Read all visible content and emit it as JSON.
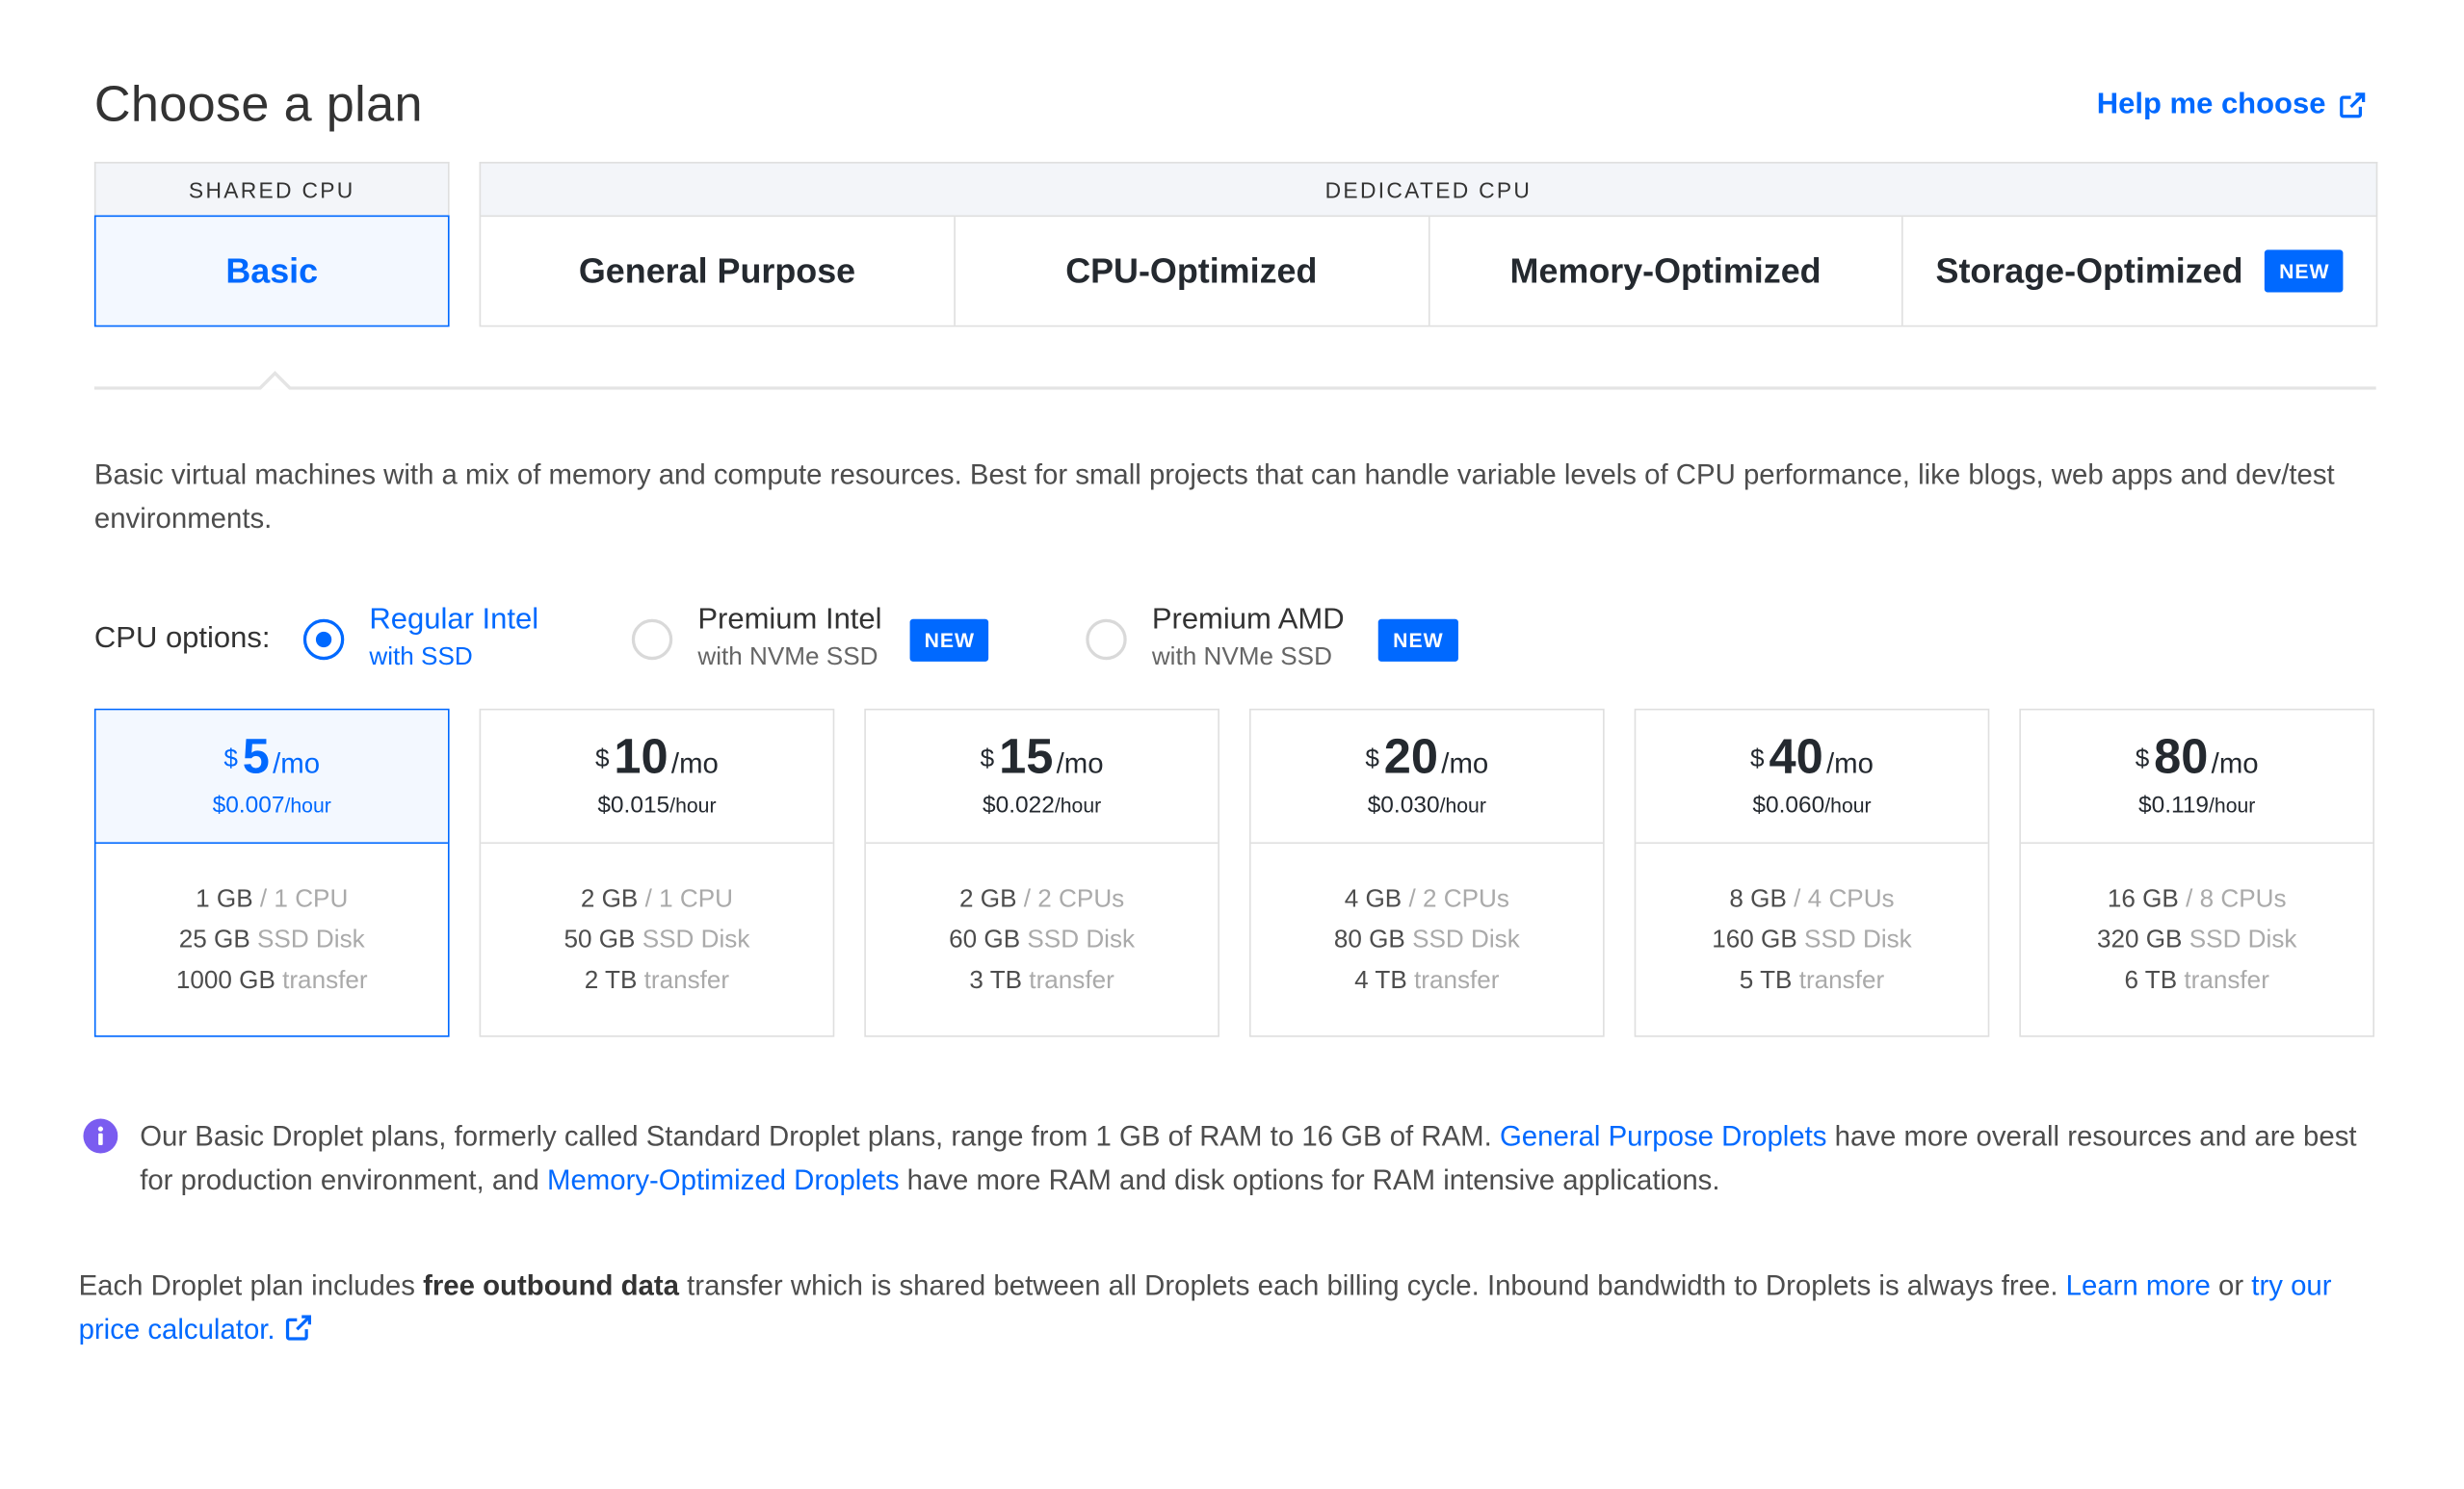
{
  "header": {
    "title": "Choose a plan",
    "help_label": "Help me choose"
  },
  "tab_groups": {
    "shared_label": "SHARED CPU",
    "dedicated_label": "DEDICATED CPU"
  },
  "tabs": [
    {
      "label": "Basic",
      "selected": true
    },
    {
      "label": "General Purpose"
    },
    {
      "label": "CPU-Optimized"
    },
    {
      "label": "Memory-Optimized"
    },
    {
      "label": "Storage-Optimized",
      "badge": "NEW"
    }
  ],
  "description": "Basic virtual machines with a mix of memory and compute resources. Best for small projects that can handle variable levels of CPU performance, like blogs, web apps and dev/test environments.",
  "cpu_options": {
    "label": "CPU options:",
    "options": [
      {
        "label": "Regular Intel",
        "sub": "with SSD",
        "selected": true
      },
      {
        "label": "Premium Intel",
        "sub": "with NVMe SSD",
        "badge": "NEW"
      },
      {
        "label": "Premium AMD",
        "sub": "with NVMe SSD",
        "badge": "NEW"
      }
    ]
  },
  "plans": [
    {
      "currency": "$",
      "amount": "5",
      "per": "/mo",
      "hourly": "$0.007",
      "hour_unit": "/hour",
      "ram": "1 GB",
      "cpu": "/ 1 CPU",
      "disk": "25 GB",
      "disk_unit": "SSD Disk",
      "transfer": "1000 GB",
      "transfer_unit": "transfer",
      "selected": true
    },
    {
      "currency": "$",
      "amount": "10",
      "per": "/mo",
      "hourly": "$0.015",
      "hour_unit": "/hour",
      "ram": "2 GB",
      "cpu": "/ 1 CPU",
      "disk": "50 GB",
      "disk_unit": "SSD Disk",
      "transfer": "2 TB",
      "transfer_unit": "transfer"
    },
    {
      "currency": "$",
      "amount": "15",
      "per": "/mo",
      "hourly": "$0.022",
      "hour_unit": "/hour",
      "ram": "2 GB",
      "cpu": "/ 2 CPUs",
      "disk": "60 GB",
      "disk_unit": "SSD Disk",
      "transfer": "3 TB",
      "transfer_unit": "transfer"
    },
    {
      "currency": "$",
      "amount": "20",
      "per": "/mo",
      "hourly": "$0.030",
      "hour_unit": "/hour",
      "ram": "4 GB",
      "cpu": "/ 2 CPUs",
      "disk": "80 GB",
      "disk_unit": "SSD Disk",
      "transfer": "4 TB",
      "transfer_unit": "transfer"
    },
    {
      "currency": "$",
      "amount": "40",
      "per": "/mo",
      "hourly": "$0.060",
      "hour_unit": "/hour",
      "ram": "8 GB",
      "cpu": "/ 4 CPUs",
      "disk": "160 GB",
      "disk_unit": "SSD Disk",
      "transfer": "5 TB",
      "transfer_unit": "transfer"
    },
    {
      "currency": "$",
      "amount": "80",
      "per": "/mo",
      "hourly": "$0.119",
      "hour_unit": "/hour",
      "ram": "16 GB",
      "cpu": "/ 8 CPUs",
      "disk": "320 GB",
      "disk_unit": "SSD Disk",
      "transfer": "6 TB",
      "transfer_unit": "transfer"
    }
  ],
  "info": {
    "part1": "Our Basic Droplet plans, formerly called Standard Droplet plans, range from 1 GB of RAM to 16 GB of RAM. ",
    "link1": "General Purpose Droplets",
    "part2": " have more overall resources and are best for production environment, and ",
    "link2": "Memory-Optimized Droplets",
    "part3": " have more RAM and disk options for RAM intensive applications."
  },
  "footer": {
    "part1": "Each Droplet plan includes ",
    "bold": "free outbound data",
    "part2": " transfer which is shared between all Droplets each billing cycle. Inbound bandwidth to Droplets is always free. ",
    "link1": "Learn more",
    "part3": " or ",
    "link2": "try our price calculator."
  },
  "colors": {
    "accent": "#0069ff",
    "info_icon": "#7a5cf0",
    "border": "#dfdfdf",
    "selected_bg": "#f3f8ff"
  }
}
